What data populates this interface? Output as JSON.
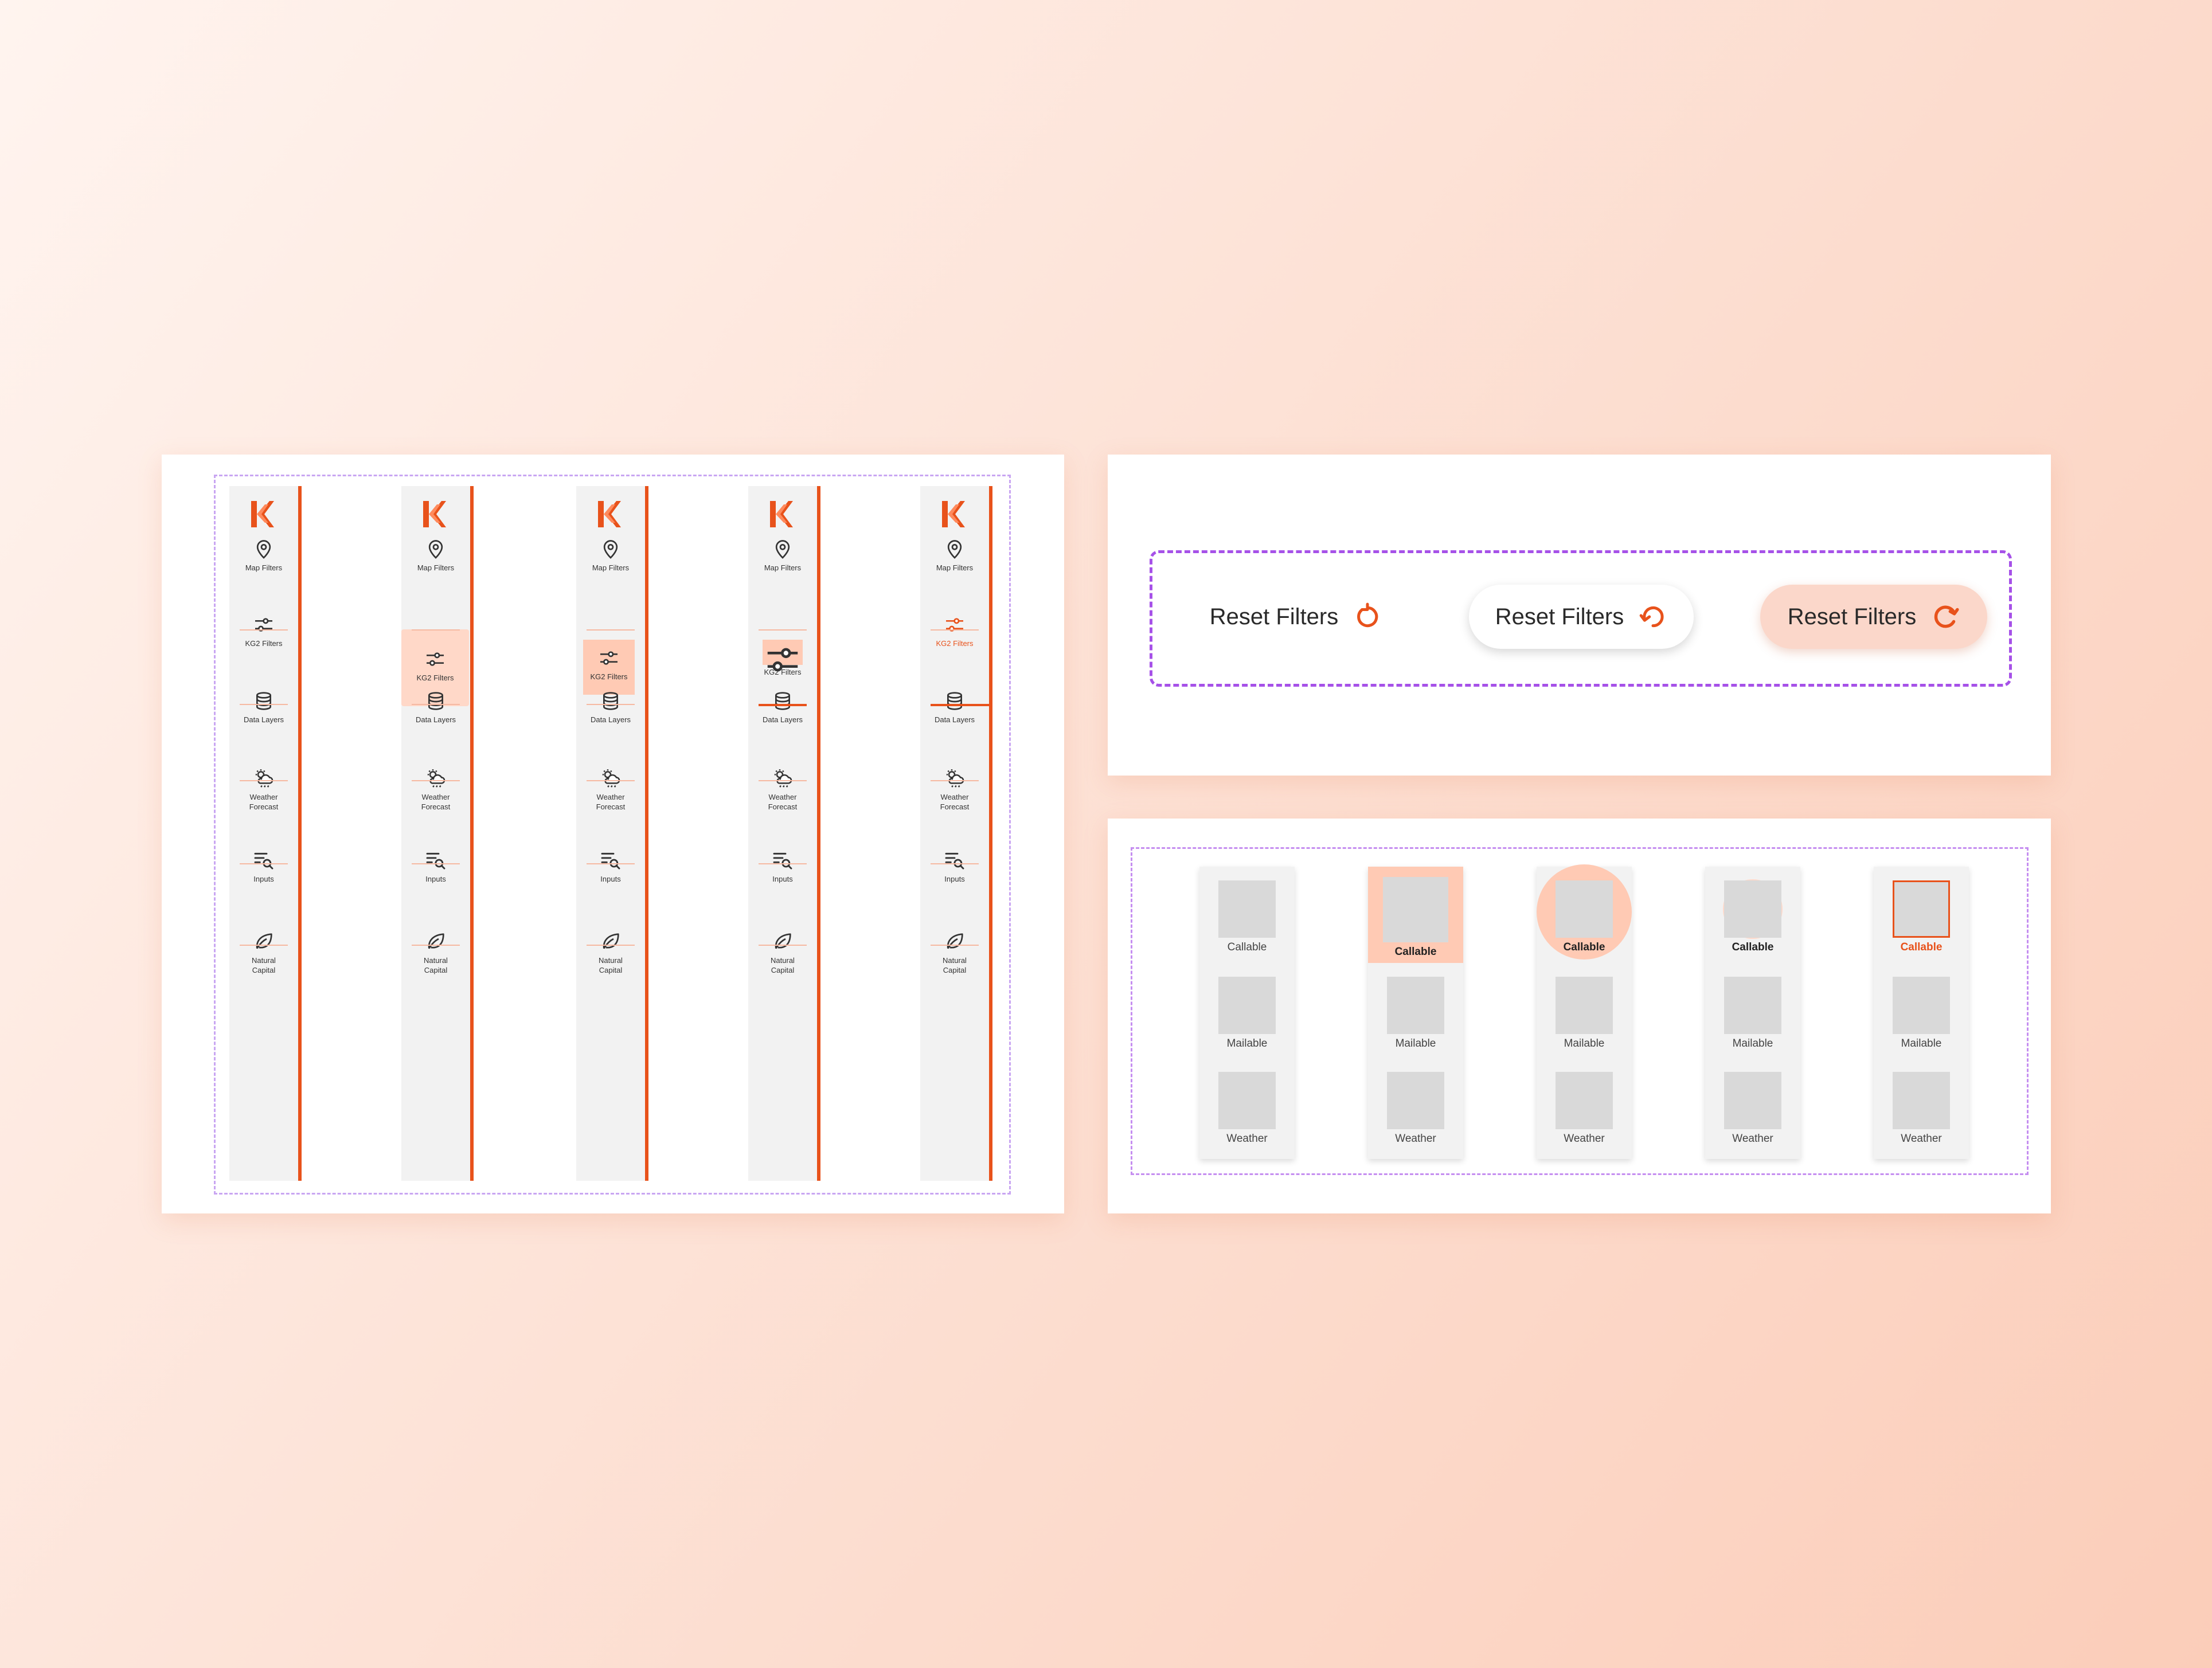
{
  "sidebar": {
    "variants": 5,
    "items": [
      {
        "key": "map",
        "icon": "map-pin-icon",
        "label": "Map Filters"
      },
      {
        "key": "kg2",
        "icon": "sliders-icon",
        "label": "KG2 Filters"
      },
      {
        "key": "data",
        "icon": "database-icon",
        "label": "Data Layers"
      },
      {
        "key": "weather",
        "icon": "weather-cloud-icon",
        "label": "Weather\nForecast"
      },
      {
        "key": "inputs",
        "icon": "list-search-icon",
        "label": "Inputs"
      },
      {
        "key": "natural",
        "icon": "leaf-icon",
        "label": "Natural\nCapital"
      }
    ]
  },
  "reset": {
    "label": "Reset Filters",
    "icon": "refresh-icon"
  },
  "tiles": {
    "labels": [
      "Callable",
      "Mailable",
      "Weather"
    ],
    "columns": 5
  },
  "colors": {
    "accent": "#e8521b",
    "accent_light": "#fbd7ca",
    "guide_purple": "#a651e8"
  }
}
